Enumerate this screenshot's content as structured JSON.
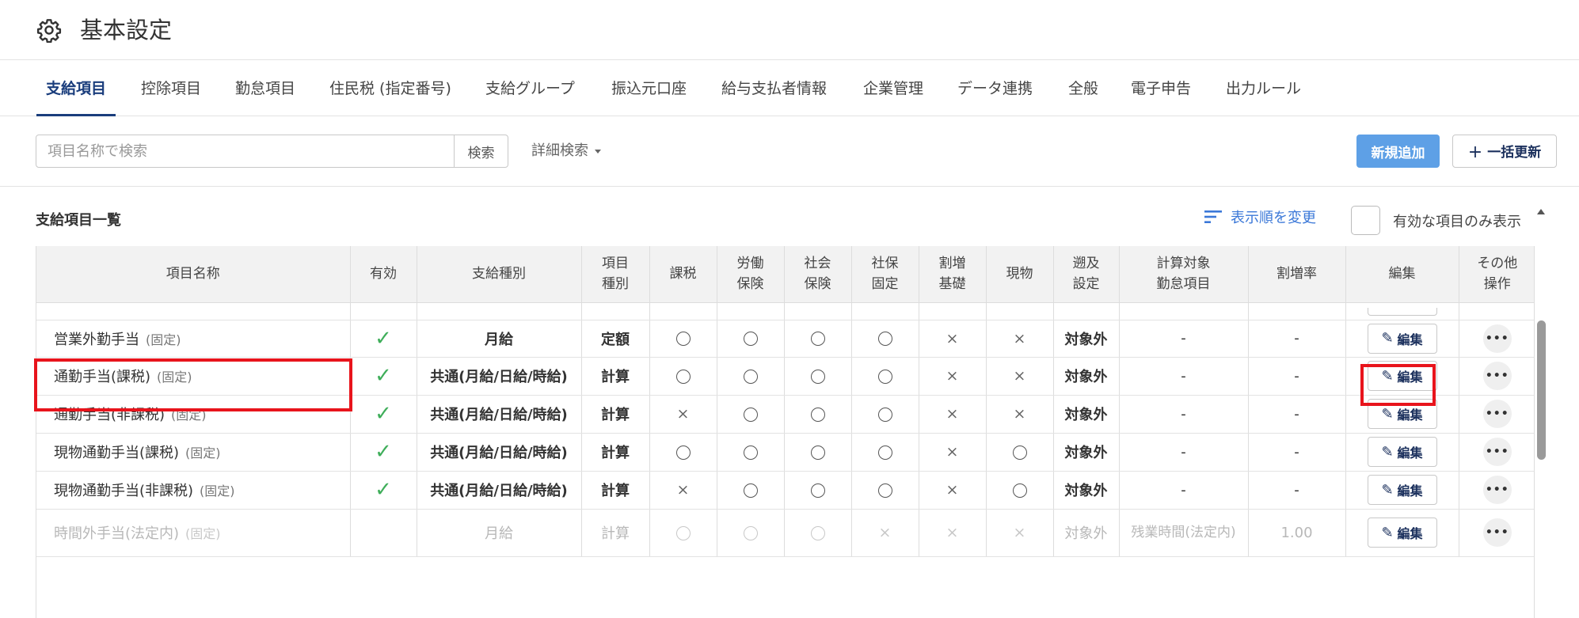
{
  "page": {
    "title": "基本設定",
    "title_icon": "gear-icon"
  },
  "tabs": [
    {
      "label": "支給項目",
      "active": true
    },
    {
      "label": "控除項目"
    },
    {
      "label": "勤怠項目"
    },
    {
      "label": "住民税 (指定番号)"
    },
    {
      "label": "支給グループ"
    },
    {
      "label": "振込元口座"
    },
    {
      "label": "給与支払者情報"
    },
    {
      "label": "企業管理"
    },
    {
      "label": "データ連携"
    },
    {
      "label": "全般"
    },
    {
      "label": "電子申告"
    },
    {
      "label": "出力ルール"
    }
  ],
  "toolbar": {
    "search_placeholder": "項目名称で検索",
    "search_label": "検索",
    "advanced_search_label": "詳細検索",
    "new_label": "新規追加",
    "bulk_update_label": "一括更新",
    "new_button_color": "#5ea0e6"
  },
  "list": {
    "title": "支給項目一覧",
    "sort_label": "表示順を変更",
    "only_active_label": "有効な項目のみ表示"
  },
  "table": {
    "headers": [
      [
        "項目名称"
      ],
      [
        "有効"
      ],
      [
        "支給種別"
      ],
      [
        "項目",
        "種別"
      ],
      [
        "課税"
      ],
      [
        "労働",
        "保険"
      ],
      [
        "社会",
        "保険"
      ],
      [
        "社保",
        "固定"
      ],
      [
        "割増",
        "基礎"
      ],
      [
        "現物"
      ],
      [
        "遡及",
        "設定"
      ],
      [
        "計算対象",
        "勤怠項目"
      ],
      [
        "割増率"
      ],
      [
        "編集"
      ],
      [
        "その他",
        "操作"
      ]
    ],
    "rows": [
      {
        "name": "営業外勤手当",
        "tag": "(固定)",
        "active": true,
        "pay_type": "月給",
        "item_type": "定額",
        "tax": "o",
        "labor": "o",
        "social": "o",
        "social_fixed": "o",
        "premium_base": "x",
        "in_kind": "x",
        "retro": "対象外",
        "attendance": "-",
        "rate": "-",
        "edit_label": "編集",
        "disabled": false
      },
      {
        "name": "通勤手当(課税)",
        "tag": "(固定)",
        "active": true,
        "pay_type": "共通(月給/日給/時給)",
        "item_type": "計算",
        "tax": "o",
        "labor": "o",
        "social": "o",
        "social_fixed": "o",
        "premium_base": "x",
        "in_kind": "x",
        "retro": "対象外",
        "attendance": "-",
        "rate": "-",
        "edit_label": "編集",
        "disabled": false
      },
      {
        "name": "通勤手当(非課税)",
        "tag": "(固定)",
        "active": true,
        "pay_type": "共通(月給/日給/時給)",
        "item_type": "計算",
        "tax": "x",
        "labor": "o",
        "social": "o",
        "social_fixed": "o",
        "premium_base": "x",
        "in_kind": "x",
        "retro": "対象外",
        "attendance": "-",
        "rate": "-",
        "edit_label": "編集",
        "disabled": false
      },
      {
        "name": "現物通勤手当(課税)",
        "tag": "(固定)",
        "active": true,
        "pay_type": "共通(月給/日給/時給)",
        "item_type": "計算",
        "tax": "o",
        "labor": "o",
        "social": "o",
        "social_fixed": "o",
        "premium_base": "x",
        "in_kind": "o",
        "retro": "対象外",
        "attendance": "-",
        "rate": "-",
        "edit_label": "編集",
        "disabled": false
      },
      {
        "name": "現物通勤手当(非課税)",
        "tag": "(固定)",
        "active": true,
        "pay_type": "共通(月給/日給/時給)",
        "item_type": "計算",
        "tax": "x",
        "labor": "o",
        "social": "o",
        "social_fixed": "o",
        "premium_base": "x",
        "in_kind": "o",
        "retro": "対象外",
        "attendance": "-",
        "rate": "-",
        "edit_label": "編集",
        "disabled": false
      },
      {
        "name": "時間外手当(法定内)",
        "tag": "(固定)",
        "active": false,
        "pay_type": "月給",
        "item_type": "計算",
        "tax": "o",
        "labor": "o",
        "social": "o",
        "social_fixed": "x",
        "premium_base": "x",
        "in_kind": "x",
        "retro": "対象外",
        "attendance": "残業時間(法定内)",
        "rate": "1.00",
        "edit_label": "編集",
        "disabled": true
      }
    ]
  },
  "highlight_color": "#e8141c"
}
